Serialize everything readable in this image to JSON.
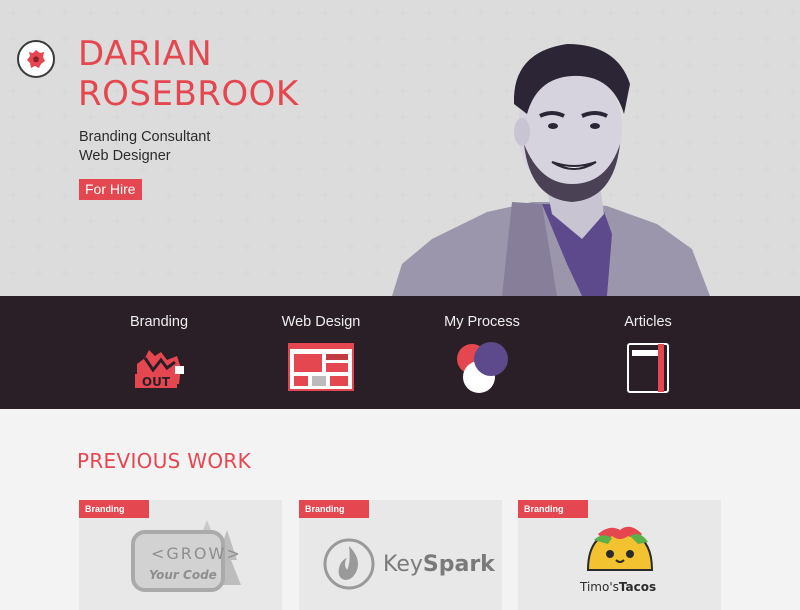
{
  "header": {
    "name_line1": "DARIAN",
    "name_line2": "ROSEBROOK",
    "role1": "Branding Consultant",
    "role2": "Web Designer",
    "hire_button": "For Hire"
  },
  "nav": {
    "items": [
      {
        "label": "Branding",
        "icon": "branding-out-icon"
      },
      {
        "label": "Web Design",
        "icon": "web-design-icon"
      },
      {
        "label": "My Process",
        "icon": "process-circles-icon"
      },
      {
        "label": "Articles",
        "icon": "notebook-icon"
      }
    ]
  },
  "work": {
    "title": "PREVIOUS WORK",
    "cards": [
      {
        "tag": "Branding",
        "logo": "grow-your-code-logo",
        "text1": "GROW",
        "text2": "Your Code"
      },
      {
        "tag": "Branding",
        "logo": "keyspark-logo",
        "text_a": "Key",
        "text_b": "Spark"
      },
      {
        "tag": "Branding",
        "logo": "timos-tacos-logo",
        "text_a": "Timo's",
        "text_b": "Tacos"
      }
    ]
  },
  "colors": {
    "accent": "#e4474f",
    "nav_bg": "#2b1f27",
    "purple": "#5c4a8c"
  }
}
